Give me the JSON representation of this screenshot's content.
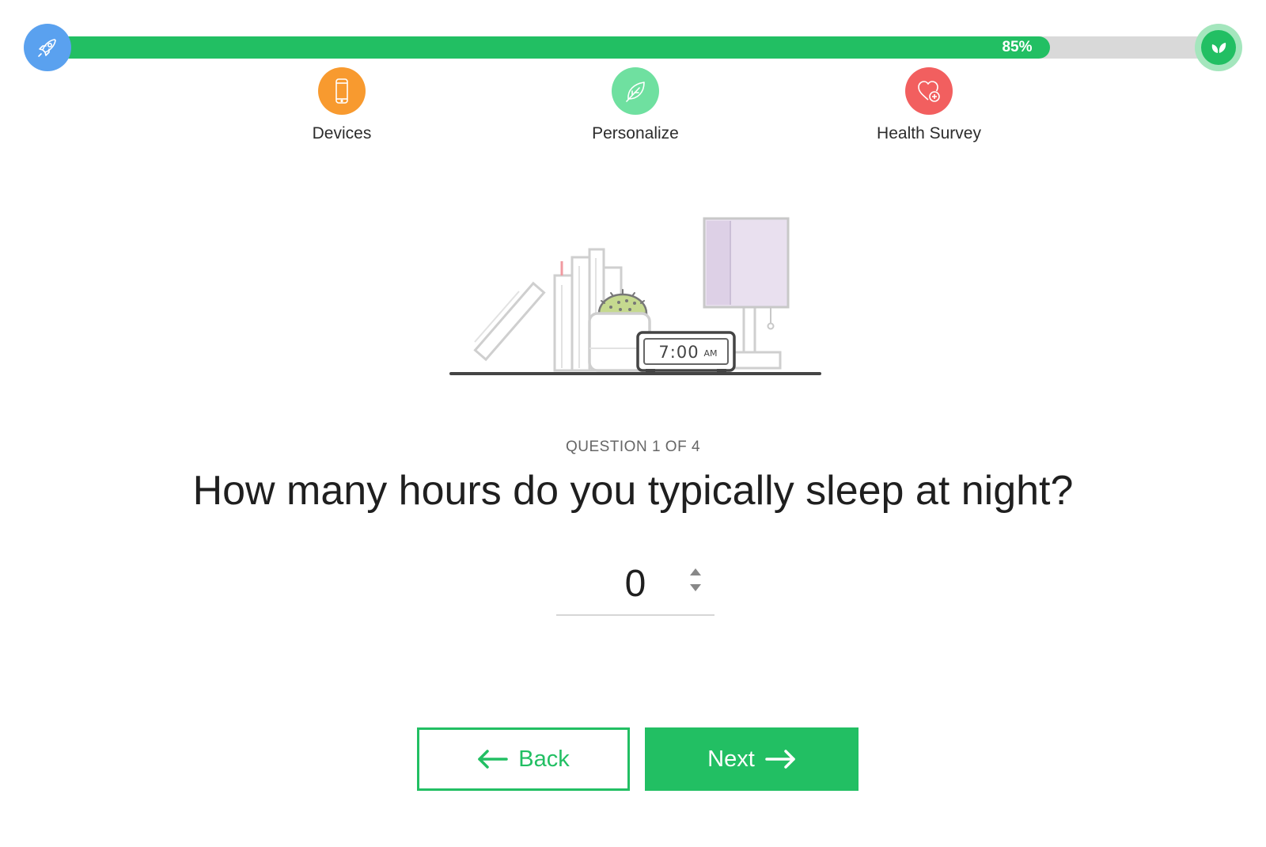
{
  "progress": {
    "percent": 85,
    "label": "85%",
    "colors": {
      "fill": "#22bf63",
      "track": "#d9d9d9"
    },
    "start_icon": "rocket-icon",
    "end_icon": "leaves-icon"
  },
  "steps": [
    {
      "label": "Devices",
      "icon": "phone-icon",
      "color": "#f89a2f"
    },
    {
      "label": "Personalize",
      "icon": "leaf-icon",
      "color": "#6fe0a0"
    },
    {
      "label": "Health Survey",
      "icon": "heart-plus-icon",
      "color": "#f25f5f"
    }
  ],
  "illustration": {
    "clock_time": "7:00",
    "clock_period": "AM"
  },
  "question": {
    "counter": "QUESTION 1 OF 4",
    "text": "How many hours do you typically sleep at night?"
  },
  "answer": {
    "value": "0"
  },
  "buttons": {
    "back_label": "Back",
    "next_label": "Next"
  },
  "colors": {
    "accent": "#22bf63"
  }
}
